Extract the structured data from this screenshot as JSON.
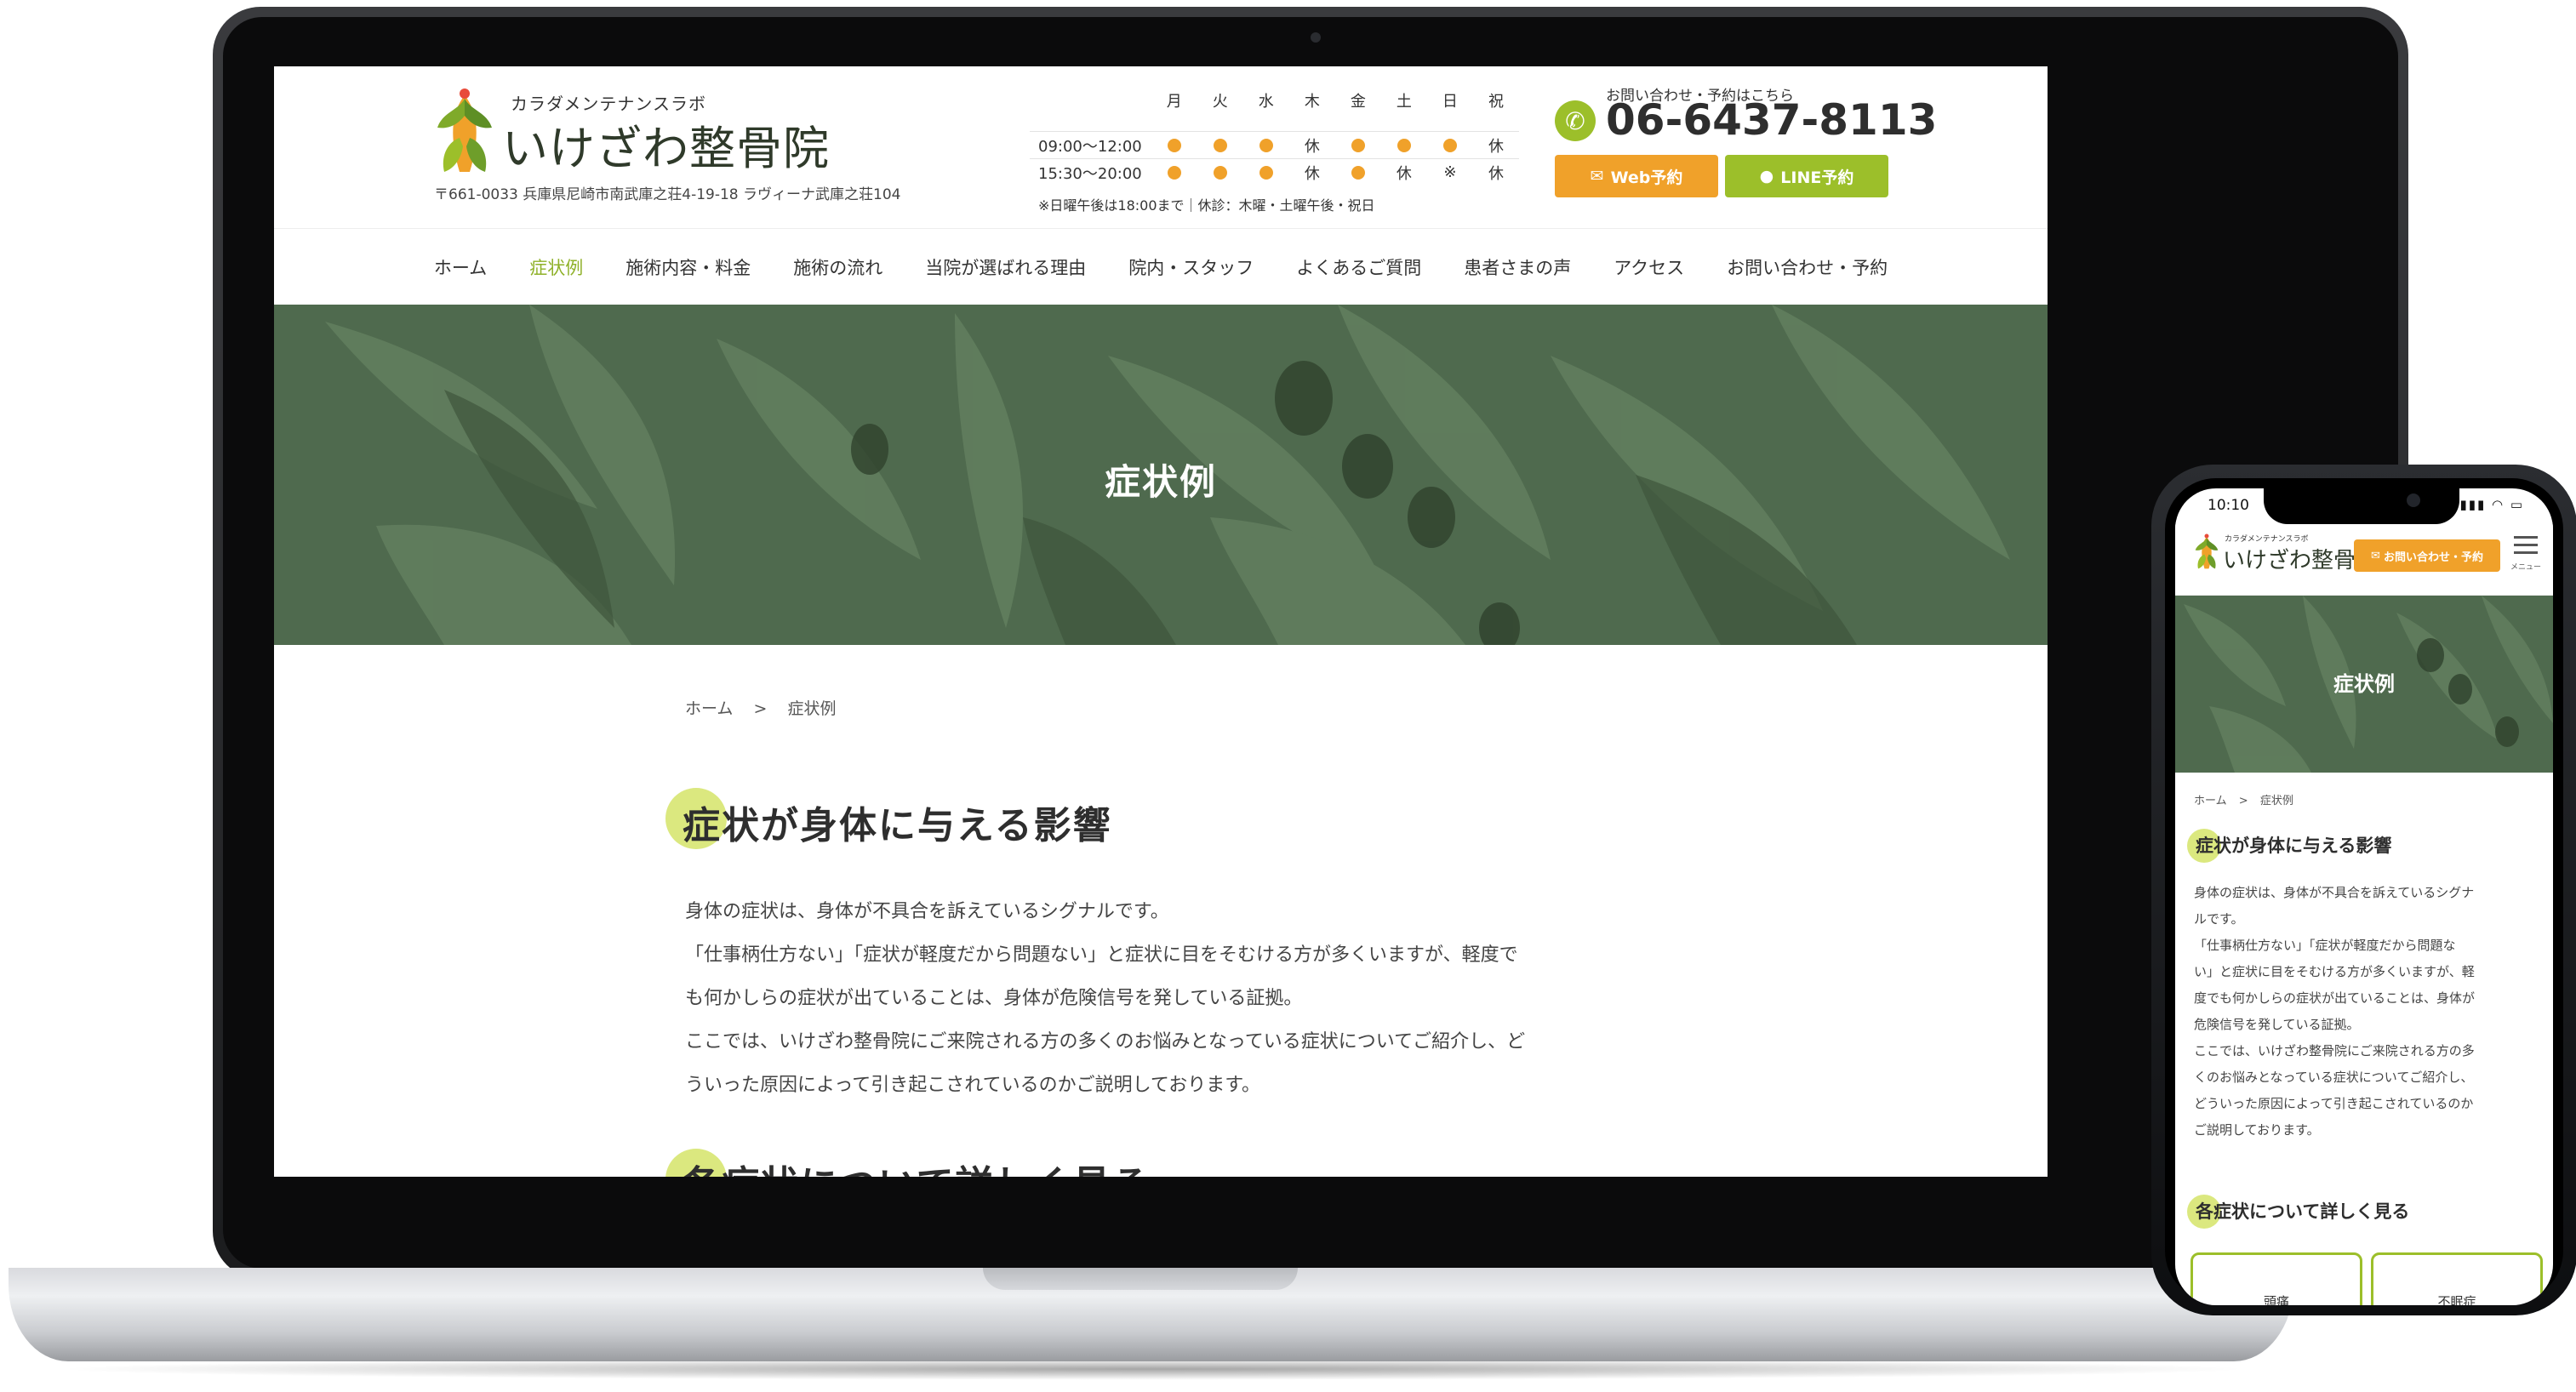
{
  "desktop": {
    "logo": {
      "sub": "カラダメンテナンスラボ",
      "main": "いけざわ整骨院"
    },
    "address": "〒661-0033 兵庫県尼崎市南武庫之荘4-19-18 ラヴィーナ武庫之荘104",
    "schedule": {
      "days": [
        "月",
        "火",
        "水",
        "木",
        "金",
        "土",
        "日",
        "祝"
      ],
      "rows": [
        {
          "time": "09:00〜12:00",
          "cells": [
            "●",
            "●",
            "●",
            "休",
            "●",
            "●",
            "●",
            "休"
          ]
        },
        {
          "time": "15:30〜20:00",
          "cells": [
            "●",
            "●",
            "●",
            "休",
            "●",
            "休",
            "※",
            "休"
          ]
        }
      ],
      "note": "※日曜午後は18:00まで｜休診：木曜・土曜午後・祝日"
    },
    "contact": {
      "label": "お問い合わせ・予約はこちら",
      "phone": "06-6437-8113",
      "web_button": "Web予約",
      "line_button": "LINE予約"
    },
    "nav": [
      "ホーム",
      "症状例",
      "施術内容・料金",
      "施術の流れ",
      "当院が選ばれる理由",
      "院内・スタッフ",
      "よくあるご質問",
      "患者さまの声",
      "アクセス",
      "お問い合わせ・予約"
    ],
    "nav_active_index": 1,
    "hero_title": "症状例",
    "breadcrumb": {
      "home": "ホーム",
      "sep": ">",
      "current": "症状例"
    },
    "section1_title": "症状が身体に与える影響",
    "body": [
      "身体の症状は、身体が不具合を訴えているシグナルです。",
      "「仕事柄仕方ない」「症状が軽度だから問題ない」と症状に目をそむける方が多くいますが、軽度で",
      "も何かしらの症状が出ていることは、身体が危険信号を発している証拠。",
      "ここでは、いけざわ整骨院にご来院される方の多くのお悩みとなっている症状についてご紹介し、ど",
      "ういった原因によって引き起こされているのかご説明しております。"
    ],
    "section2_title": "各症状について詳しく見る"
  },
  "mobile": {
    "time": "10:10",
    "logo": {
      "sub": "カラダメンテナンスラボ",
      "main": "いけざわ整骨院"
    },
    "contact_button": "お問い合わせ・予約",
    "menu_label": "メニュー",
    "hero_title": "症状例",
    "breadcrumb": {
      "home": "ホーム",
      "sep": ">",
      "current": "症状例"
    },
    "section1_title": "症状が身体に与える影響",
    "body": [
      "身体の症状は、身体が不具合を訴えているシグナ",
      "ルです。",
      "「仕事柄仕方ない」「症状が軽度だから問題な",
      "い」と症状に目をそむける方が多くいますが、軽",
      "度でも何かしらの症状が出ていることは、身体が",
      "危険信号を発している証拠。",
      "ここでは、いけざわ整骨院にご来院される方の多",
      "くのお悩みとなっている症状についてご紹介し、",
      "どういった原因によって引き起こされているのか",
      "ご説明しております。"
    ],
    "section2_title": "各症状について詳しく見る",
    "cards": [
      "頭痛",
      "不眠症"
    ]
  },
  "colors": {
    "accent_green": "#9cbf2a",
    "accent_orange": "#f0a12a",
    "hero_green": "#4f6a4e",
    "highlight": "#dbe87f"
  }
}
